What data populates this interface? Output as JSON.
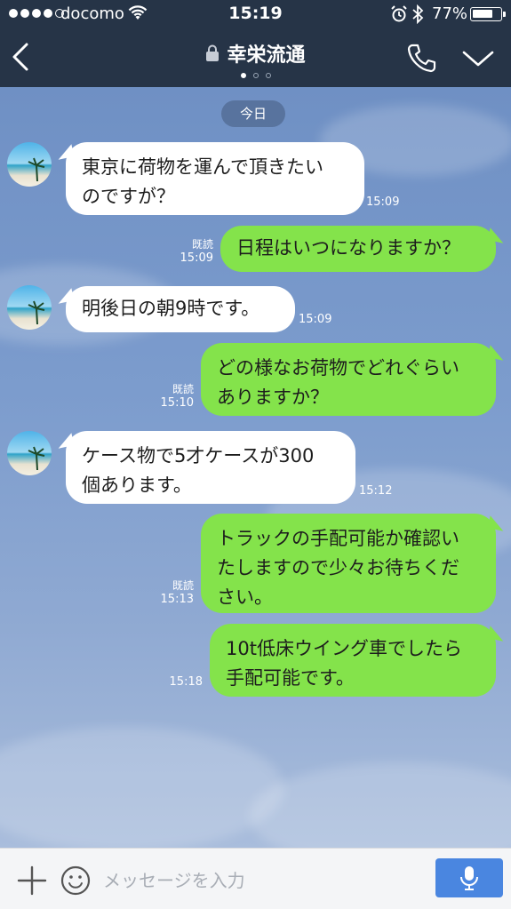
{
  "status_bar": {
    "carrier": "docomo",
    "time": "15:19",
    "battery": "77%",
    "battery_level": 0.77,
    "icons": [
      "signal-icon",
      "wifi-icon",
      "alarm-icon",
      "bluetooth-icon",
      "battery-icon"
    ]
  },
  "nav": {
    "title": "幸栄流通",
    "page_count": 3,
    "active_page": 1,
    "icons": [
      "back-icon",
      "lock-icon",
      "phone-icon",
      "chevron-down-icon"
    ]
  },
  "chat": {
    "date_label": "今日",
    "messages": [
      {
        "side": "in",
        "lines": [
          "東京に荷物を運んで頂きたい",
          "のですが？"
        ],
        "time": "15:09",
        "read": ""
      },
      {
        "side": "out",
        "lines": [
          "日程はいつになりますか？"
        ],
        "time": "15:09",
        "read": "既読"
      },
      {
        "side": "in",
        "lines": [
          "明後日の朝9時です。"
        ],
        "time": "15:09",
        "read": ""
      },
      {
        "side": "out",
        "lines": [
          "どの様なお荷物でどれぐらい",
          "ありますか？"
        ],
        "time": "15:10",
        "read": "既読"
      },
      {
        "side": "in",
        "lines": [
          "ケース物で5才ケースが300",
          "個あります。"
        ],
        "time": "15:12",
        "read": ""
      },
      {
        "side": "out",
        "lines": [
          "トラックの手配可能か確認い",
          "たしますので少々お待ちくだ",
          "さい。"
        ],
        "time": "15:13",
        "read": "既読"
      },
      {
        "side": "out",
        "lines": [
          "10t低床ウイング車でしたら",
          "手配可能です。"
        ],
        "time": "15:18",
        "read": ""
      }
    ]
  },
  "input_bar": {
    "placeholder": "メッセージを入力",
    "icons": [
      "plus-icon",
      "smile-icon",
      "mic-icon"
    ],
    "accent_color": "#4a86e0"
  },
  "colors": {
    "header_bg": "#263447",
    "outgoing_bubble": "#84e34b",
    "incoming_bubble": "#ffffff",
    "chat_bg": "#7b9ac9"
  }
}
